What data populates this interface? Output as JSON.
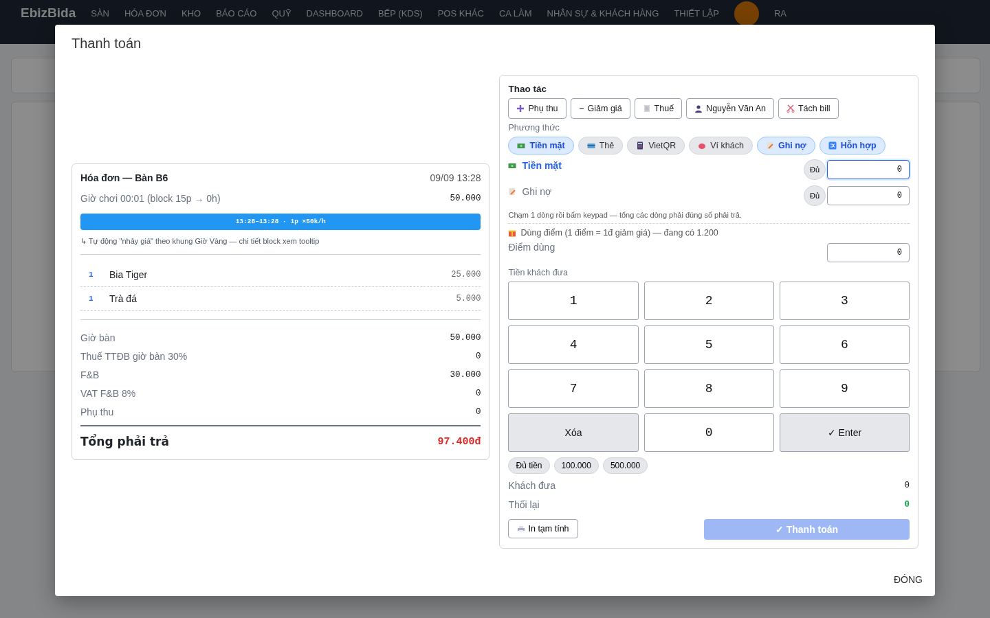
{
  "nav": {
    "brand": "EbizBida",
    "items": [
      {
        "label": "SÀN"
      },
      {
        "label": "HÓA ĐƠN"
      },
      {
        "label": "KHO"
      },
      {
        "label": "BÁO CÁO"
      },
      {
        "label": "QUỸ"
      },
      {
        "label": "DASHBOARD"
      },
      {
        "label": "BẾP (KDS)"
      },
      {
        "label": "POS KHÁC"
      },
      {
        "label": "CA LÀM"
      },
      {
        "label": "NHÂN SỰ & KHÁCH HÀNG"
      },
      {
        "label": "THIẾT LẬP"
      }
    ],
    "exit": "RA"
  },
  "modal": {
    "title": "Thanh toán",
    "close": "ĐÓNG"
  },
  "invoice": {
    "title": "Hóa đơn — Bàn B6",
    "time": "09/09 13:28",
    "play": {
      "label": "Giờ chơi 00:01 (block 15p → 0h)",
      "amount": "50.000"
    },
    "block": "13:28–13:28 · 1p ×50k/h",
    "note": "↳ Tự động \"nhảy giá\" theo khung Giờ Vàng — chi tiết block xem tooltip",
    "items": [
      {
        "qty": "1",
        "name": "Bia Tiger",
        "price": "25.000"
      },
      {
        "qty": "1",
        "name": "Trà đá",
        "price": "5.000"
      }
    ],
    "summary": [
      {
        "label": "Giờ bàn",
        "value": "50.000"
      },
      {
        "label": "Thuế TTĐB giờ bàn 30%",
        "value": "0"
      },
      {
        "label": "F&B",
        "value": "30.000"
      },
      {
        "label": "VAT F&B 8%",
        "value": "0"
      },
      {
        "label": "Phụ thu",
        "value": "0"
      }
    ],
    "total": {
      "label": "Tổng phải trả",
      "value": "97.400đ"
    }
  },
  "actions": {
    "title": "Thao tác",
    "buttons": [
      {
        "kind": "plus",
        "label": "Phụ thu"
      },
      {
        "kind": "minus",
        "label": "Giảm giá"
      },
      {
        "kind": "receipt",
        "label": "Thuế"
      },
      {
        "kind": "person",
        "label": "Nguyễn Văn An"
      },
      {
        "kind": "scissors",
        "label": "Tách bill"
      }
    ]
  },
  "methods": {
    "label": "Phương thức",
    "items": [
      {
        "kind": "cash",
        "label": "Tiền mặt",
        "selected": true
      },
      {
        "kind": "card",
        "label": "Thẻ",
        "selected": false
      },
      {
        "kind": "qr",
        "label": "VietQR",
        "selected": false
      },
      {
        "kind": "wallet",
        "label": "Ví khách",
        "selected": false
      },
      {
        "kind": "debt",
        "label": "Ghi nợ",
        "selected": true
      },
      {
        "kind": "mixed",
        "label": "Hỗn hợp",
        "selected": true
      }
    ]
  },
  "split_lines": [
    {
      "kind": "cash",
      "label": "Tiền mặt",
      "selected": true,
      "fill": "Đủ",
      "value": "0"
    },
    {
      "kind": "debt",
      "label": "Ghi nợ",
      "selected": false,
      "fill": "Đủ",
      "value": "0"
    }
  ],
  "hint": "Chạm 1 dòng rồi bấm keypad — tổng các dòng phải đúng số phải trả.",
  "points": {
    "label": "Dùng điểm (1 điểm = 1đ giảm giá) — đang có 1.200",
    "field_label": "Điểm dùng",
    "value": "0"
  },
  "keypad": {
    "label": "Tiền khách đưa",
    "keys": [
      {
        "kind": "digit",
        "label": "1"
      },
      {
        "kind": "digit",
        "label": "2"
      },
      {
        "kind": "digit",
        "label": "3"
      },
      {
        "kind": "digit",
        "label": "4"
      },
      {
        "kind": "digit",
        "label": "5"
      },
      {
        "kind": "digit",
        "label": "6"
      },
      {
        "kind": "digit",
        "label": "7"
      },
      {
        "kind": "digit",
        "label": "8"
      },
      {
        "kind": "digit",
        "label": "9"
      },
      {
        "kind": "action",
        "label": "Xóa"
      },
      {
        "kind": "digit",
        "label": "0"
      },
      {
        "kind": "action",
        "label": "✓ Enter"
      }
    ]
  },
  "quick": [
    {
      "label": "Đủ tiền"
    },
    {
      "label": "100.000"
    },
    {
      "label": "500.000"
    }
  ],
  "paid": {
    "label": "Khách đưa",
    "value": "0"
  },
  "change": {
    "label": "Thối lại",
    "value": "0"
  },
  "print_button": "In tạm tính",
  "pay_button": {
    "label": "✓ Thanh toán",
    "disabled": true
  }
}
